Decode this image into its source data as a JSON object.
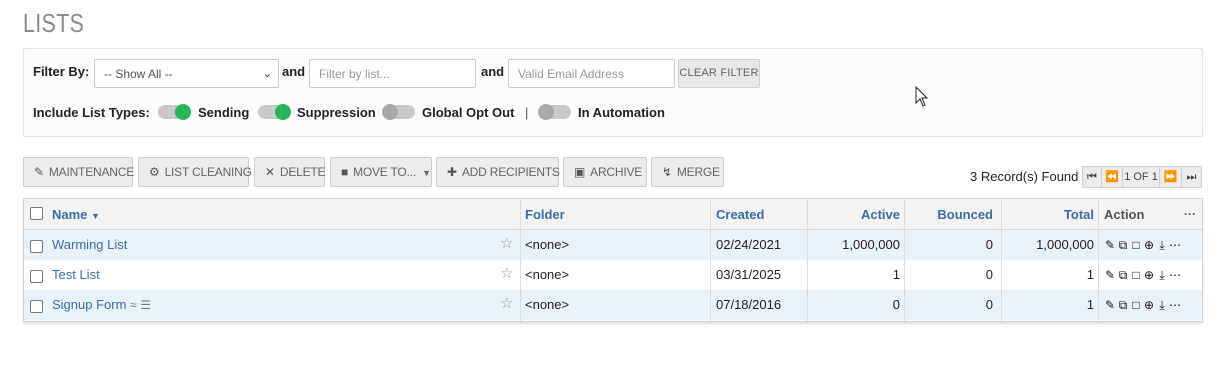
{
  "page_title": "LISTS",
  "filter": {
    "filter_by_label": "Filter By:",
    "show_all_value": "-- Show All --",
    "and1": "and",
    "list_placeholder": "Filter by list...",
    "and2": "and",
    "email_placeholder": "Valid Email Address",
    "clear_label": "CLEAR FILTER",
    "include_label": "Include List Types:",
    "types": [
      {
        "label": "Sending",
        "state": "on"
      },
      {
        "label": "Suppression",
        "state": "on"
      },
      {
        "label": "Global Opt Out",
        "state": "off"
      },
      {
        "label": "In Automation",
        "state": "off"
      }
    ],
    "separator": "|"
  },
  "toolbar": {
    "maintenance": "MAINTENANCE",
    "list_cleaning": "LIST CLEANING",
    "delete": "DELETE",
    "move_to": "MOVE TO...",
    "add_recipients": "ADD RECIPIENTS",
    "archive": "ARCHIVE",
    "merge": "MERGE"
  },
  "records_found": "3 Record(s) Found",
  "pager": {
    "page_label": "1 OF 1"
  },
  "table": {
    "columns": {
      "name": "Name",
      "folder": "Folder",
      "created": "Created",
      "active": "Active",
      "bounced": "Bounced",
      "total": "Total",
      "action": "Action",
      "more": "···"
    },
    "rows": [
      {
        "name": "Warming List",
        "folder": "<none>",
        "created": "02/24/2021",
        "active": "1,000,000",
        "bounced": "0",
        "total": "1,000,000"
      },
      {
        "name": "Test List",
        "folder": "<none>",
        "created": "03/31/2025",
        "active": "1",
        "bounced": "0",
        "total": "1"
      },
      {
        "name": "Signup Form",
        "folder": "<none>",
        "created": "07/18/2016",
        "active": "0",
        "bounced": "0",
        "total": "1"
      }
    ]
  },
  "colors": {
    "accent_link": "#3a6ea5",
    "toggle_on": "#27b35a",
    "row_alt": "#eaf2f9"
  }
}
